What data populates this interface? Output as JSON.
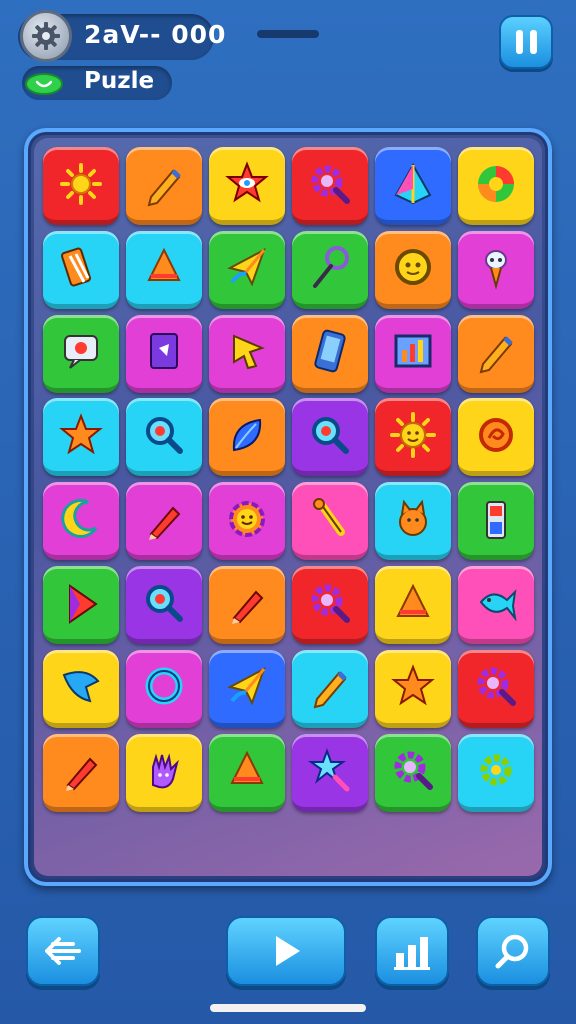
{
  "header": {
    "score_label": "2aV-- 000",
    "mode_label": "Puzle",
    "settings_icon": "gear-icon",
    "pause_icon": "pause-icon",
    "mode_icon": "heart-icon"
  },
  "colors": {
    "red": "#f0262b",
    "orange": "#ff8a1e",
    "yellow": "#ffd51a",
    "blue": "#2f6bff",
    "cyan": "#27d4f5",
    "green": "#32c63a",
    "magenta": "#e23fd6",
    "purple": "#9a35e6",
    "pink": "#ff4fb8"
  },
  "board": {
    "rows": [
      [
        {
          "color": "red",
          "icon": "sun-icon"
        },
        {
          "color": "orange",
          "icon": "pencil-icon"
        },
        {
          "color": "yellow",
          "icon": "star-eye-icon"
        },
        {
          "color": "red",
          "icon": "gear-magnifier-icon"
        },
        {
          "color": "blue",
          "icon": "pyramid-icon"
        },
        {
          "color": "yellow",
          "icon": "wheel-icon"
        }
      ],
      [
        {
          "color": "cyan",
          "icon": "ruler-icon"
        },
        {
          "color": "cyan",
          "icon": "cone-icon"
        },
        {
          "color": "green",
          "icon": "paper-plane-icon"
        },
        {
          "color": "green",
          "icon": "lasso-icon"
        },
        {
          "color": "orange",
          "icon": "face-badge-icon"
        },
        {
          "color": "magenta",
          "icon": "alien-icon"
        }
      ],
      [
        {
          "color": "green",
          "icon": "sign-icon"
        },
        {
          "color": "magenta",
          "icon": "card-icon"
        },
        {
          "color": "magenta",
          "icon": "cursor-icon"
        },
        {
          "color": "orange",
          "icon": "phone-icon"
        },
        {
          "color": "magenta",
          "icon": "chart-frame-icon"
        },
        {
          "color": "orange",
          "icon": "pencil-icon"
        }
      ],
      [
        {
          "color": "cyan",
          "icon": "star-icon"
        },
        {
          "color": "cyan",
          "icon": "magnifier-icon"
        },
        {
          "color": "orange",
          "icon": "leaf-icon"
        },
        {
          "color": "purple",
          "icon": "magnifier-icon"
        },
        {
          "color": "red",
          "icon": "sun-face-icon"
        },
        {
          "color": "yellow",
          "icon": "swirl-icon"
        }
      ],
      [
        {
          "color": "magenta",
          "icon": "moon-icon"
        },
        {
          "color": "magenta",
          "icon": "crayon-icon"
        },
        {
          "color": "magenta",
          "icon": "flower-face-icon"
        },
        {
          "color": "pink",
          "icon": "brush-icon"
        },
        {
          "color": "cyan",
          "icon": "cat-icon"
        },
        {
          "color": "green",
          "icon": "battery-icon"
        }
      ],
      [
        {
          "color": "green",
          "icon": "arrow-icon"
        },
        {
          "color": "purple",
          "icon": "magnifier-icon"
        },
        {
          "color": "orange",
          "icon": "crayon-icon"
        },
        {
          "color": "red",
          "icon": "gear-magnifier-icon"
        },
        {
          "color": "yellow",
          "icon": "cone-icon"
        },
        {
          "color": "pink",
          "icon": "fish-icon"
        }
      ],
      [
        {
          "color": "yellow",
          "icon": "fin-icon"
        },
        {
          "color": "magenta",
          "icon": "ring-icon"
        },
        {
          "color": "blue",
          "icon": "paper-plane-icon"
        },
        {
          "color": "cyan",
          "icon": "pencil-icon"
        },
        {
          "color": "yellow",
          "icon": "star-icon"
        },
        {
          "color": "red",
          "icon": "gear-magnifier-icon"
        }
      ],
      [
        {
          "color": "orange",
          "icon": "crayon-icon"
        },
        {
          "color": "yellow",
          "icon": "hand-icon"
        },
        {
          "color": "green",
          "icon": "cone-icon"
        },
        {
          "color": "purple",
          "icon": "star-wand-icon"
        },
        {
          "color": "green",
          "icon": "gear-magnifier-icon"
        },
        {
          "color": "cyan",
          "icon": "gear-icon"
        }
      ]
    ]
  },
  "footer": {
    "back_icon": "back-arrow-icon",
    "play_icon": "play-icon",
    "stats_icon": "stats-icon",
    "search_icon": "search-icon"
  }
}
